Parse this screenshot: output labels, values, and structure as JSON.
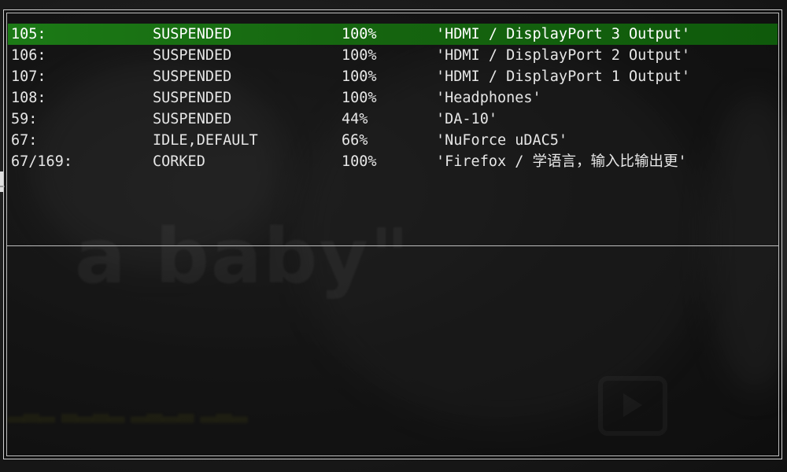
{
  "terminal": {
    "streams": [
      {
        "id": "105:",
        "state": "SUSPENDED",
        "volume": "100%",
        "name": "'HDMI / DisplayPort 3 Output'",
        "selected": true
      },
      {
        "id": "106:",
        "state": "SUSPENDED",
        "volume": "100%",
        "name": "'HDMI / DisplayPort 2 Output'",
        "selected": false
      },
      {
        "id": "107:",
        "state": "SUSPENDED",
        "volume": "100%",
        "name": "'HDMI / DisplayPort 1 Output'",
        "selected": false
      },
      {
        "id": "108:",
        "state": "SUSPENDED",
        "volume": "100%",
        "name": "'Headphones'",
        "selected": false
      },
      {
        "id": "59:",
        "state": "SUSPENDED",
        "volume": "44%",
        "name": "'DA-10'",
        "selected": false
      },
      {
        "id": "67:",
        "state": "IDLE,DEFAULT",
        "volume": "66%",
        "name": "'NuForce uDAC5'",
        "selected": false
      },
      {
        "id": "67/169:",
        "state": "CORKED",
        "volume": "100%",
        "name": "'Firefox / 学语言，输入比输出更'",
        "selected": false
      }
    ]
  },
  "background": {
    "overlay_text": "a baby\""
  },
  "colors": {
    "selection": "#1c7a16",
    "text": "#e6e6e6",
    "border": "#cfcfcf"
  }
}
